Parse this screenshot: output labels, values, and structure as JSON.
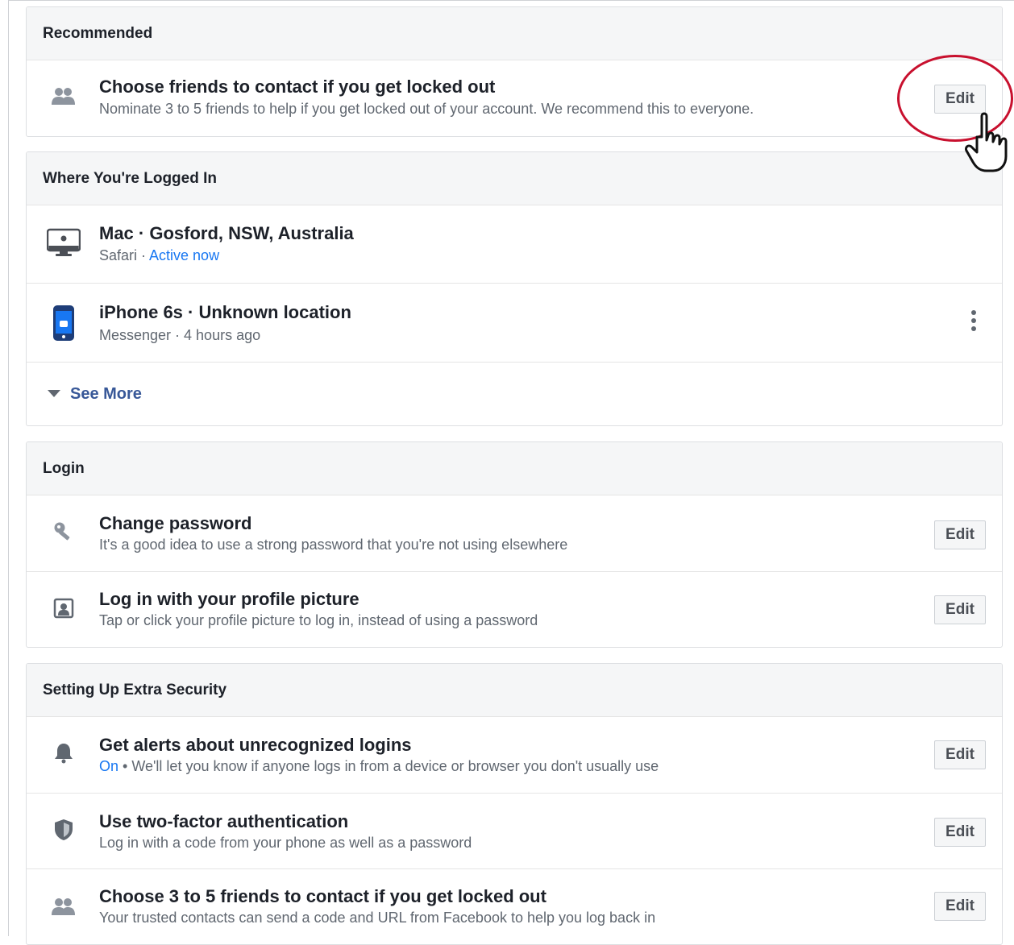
{
  "recommended": {
    "header": "Recommended",
    "item": {
      "icon": "people-icon",
      "title": "Choose friends to contact if you get locked out",
      "subtitle": "Nominate 3 to 5 friends to help if you get locked out of your account. We recommend this to everyone.",
      "button": "Edit"
    }
  },
  "logged_in": {
    "header": "Where You're Logged In",
    "sessions": [
      {
        "icon": "mac-monitor-icon",
        "title": "Mac · Gosford, NSW, Australia",
        "subtitle_prefix": "Safari · ",
        "subtitle_status": "Active now"
      },
      {
        "icon": "iphone-icon",
        "title": "iPhone 6s · Unknown location",
        "subtitle": "Messenger · 4 hours ago"
      }
    ],
    "see_more": "See More"
  },
  "login": {
    "header": "Login",
    "items": [
      {
        "icon": "key-icon",
        "title": "Change password",
        "subtitle": "It's a good idea to use a strong password that you're not using elsewhere",
        "button": "Edit"
      },
      {
        "icon": "profile-picture-icon",
        "title": "Log in with your profile picture",
        "subtitle": "Tap or click your profile picture to log in, instead of using a password",
        "button": "Edit"
      }
    ]
  },
  "extra_security": {
    "header": "Setting Up Extra Security",
    "items": [
      {
        "icon": "bell-icon",
        "title": "Get alerts about unrecognized logins",
        "status": "On",
        "subtitle": " • We'll let you know if anyone logs in from a device or browser you don't usually use",
        "button": "Edit"
      },
      {
        "icon": "shield-icon",
        "title": "Use two-factor authentication",
        "subtitle": "Log in with a code from your phone as well as a password",
        "button": "Edit"
      },
      {
        "icon": "people-icon",
        "title": "Choose 3 to 5 friends to contact if you get locked out",
        "subtitle": "Your trusted contacts can send a code and URL from Facebook to help you log back in",
        "button": "Edit"
      }
    ]
  },
  "colors": {
    "link": "#1877f2",
    "see_more": "#385898",
    "highlight": "#c8102e",
    "header_bg": "#f5f6f7"
  }
}
